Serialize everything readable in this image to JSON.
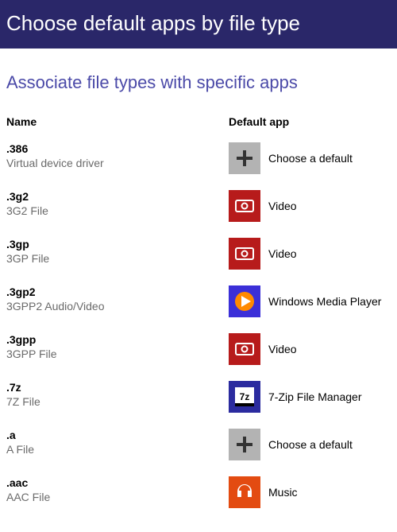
{
  "header": {
    "title": "Choose default apps by file type"
  },
  "subtitle": "Associate file types with specific apps",
  "columns": {
    "name": "Name",
    "app": "Default app"
  },
  "icons": {
    "plus": "plus-icon",
    "video": "video-icon",
    "wmp": "wmp-icon",
    "sevenzip": "sevenzip-icon",
    "music": "music-icon"
  },
  "rows": [
    {
      "ext": ".386",
      "desc": "Virtual device driver",
      "icon": "plus",
      "app": "Choose a default"
    },
    {
      "ext": ".3g2",
      "desc": "3G2 File",
      "icon": "video",
      "app": "Video"
    },
    {
      "ext": ".3gp",
      "desc": "3GP File",
      "icon": "video",
      "app": "Video"
    },
    {
      "ext": ".3gp2",
      "desc": "3GPP2 Audio/Video",
      "icon": "wmp",
      "app": "Windows Media Player"
    },
    {
      "ext": ".3gpp",
      "desc": "3GPP File",
      "icon": "video",
      "app": "Video"
    },
    {
      "ext": ".7z",
      "desc": "7Z File",
      "icon": "sevenzip",
      "app": "7-Zip File Manager"
    },
    {
      "ext": ".a",
      "desc": "A File",
      "icon": "plus",
      "app": "Choose a default"
    },
    {
      "ext": ".aac",
      "desc": "AAC File",
      "icon": "music",
      "app": "Music"
    }
  ]
}
